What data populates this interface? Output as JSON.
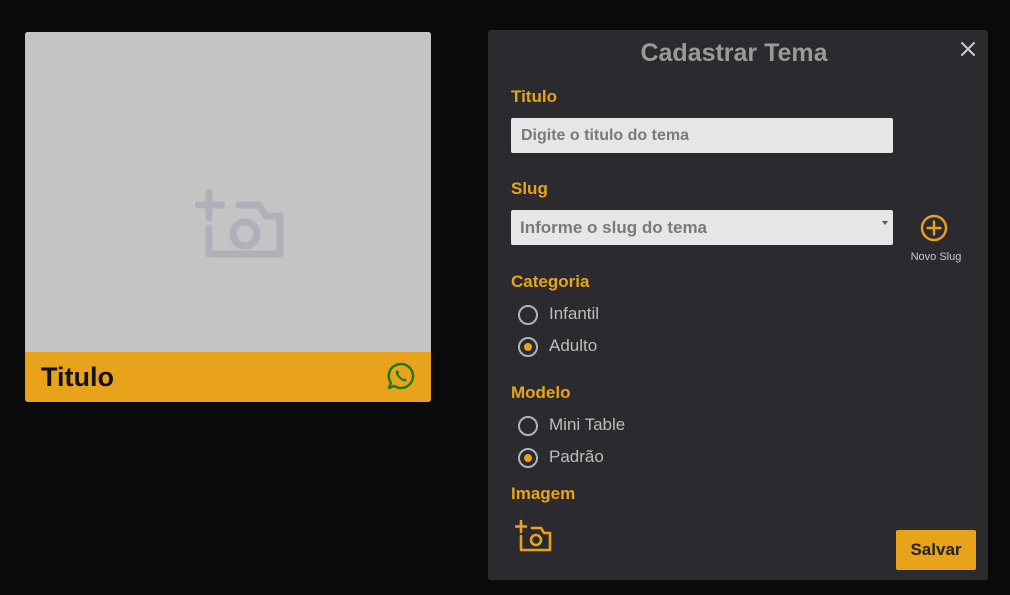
{
  "preview": {
    "title": "Titulo",
    "image_icon": "add-photo-icon",
    "share_icon": "whatsapp-icon"
  },
  "modal": {
    "title": "Cadastrar Tema",
    "close_icon": "close-icon",
    "titulo": {
      "label": "Titulo",
      "placeholder": "Digite o titulo do tema",
      "value": ""
    },
    "slug": {
      "label": "Slug",
      "selected": "Informe o slug do tema",
      "new_slug_label": "Novo Slug",
      "new_slug_icon": "plus-circle-icon"
    },
    "categoria": {
      "label": "Categoria",
      "options": [
        {
          "label": "Infantil",
          "checked": false
        },
        {
          "label": "Adulto",
          "checked": true
        }
      ]
    },
    "modelo": {
      "label": "Modelo",
      "options": [
        {
          "label": "Mini Table",
          "checked": false
        },
        {
          "label": "Padrão",
          "checked": true
        }
      ]
    },
    "imagem": {
      "label": "Imagem",
      "icon": "add-photo-icon"
    },
    "save_label": "Salvar"
  },
  "colors": {
    "accent": "#e9a31a",
    "background": "#0a0a0a",
    "modal_bg": "#2b2a2e",
    "placeholder_bg": "#c4c4c4"
  }
}
